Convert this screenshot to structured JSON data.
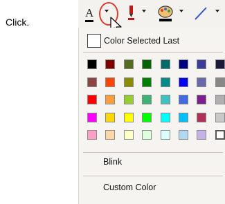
{
  "instruction": "Click.",
  "toolbar": {
    "font_letter": "A",
    "buttons": [
      "font-color",
      "highlight",
      "fill-color",
      "line-color"
    ]
  },
  "dropdown": {
    "recent_label": "Color Selected Last",
    "blink_label": "Blink",
    "custom_label": "Custom Color",
    "palette": [
      [
        "#000000",
        "#800000",
        "#556b1f",
        "#006400",
        "#006b6b",
        "#000080",
        "#3b3b9b",
        "#1a1a3a"
      ],
      [
        "#8b4543",
        "#ff4500",
        "#8b8b00",
        "#008000",
        "#008b8b",
        "#0000ff",
        "#6a6aaa",
        "#888888"
      ],
      [
        "#ff0000",
        "#ff9e3d",
        "#9acd32",
        "#3cb371",
        "#40c0c0",
        "#4169e1",
        "#7b1f8f",
        "#b0b0b0"
      ],
      [
        "#ff00ff",
        "#ffd700",
        "#ffff00",
        "#00ff00",
        "#00ffff",
        "#00bfff",
        "#b0305a",
        "#c8c8c8"
      ],
      [
        "#ff9fc6",
        "#ffd6a6",
        "#ffffc8",
        "#dcffdc",
        "#dcffff",
        "#b0d8f0",
        "#c8b0e8",
        "#ffffff"
      ]
    ],
    "selected": "#ffffff"
  },
  "colors": {
    "highlight_ring": "#e23b2a"
  }
}
